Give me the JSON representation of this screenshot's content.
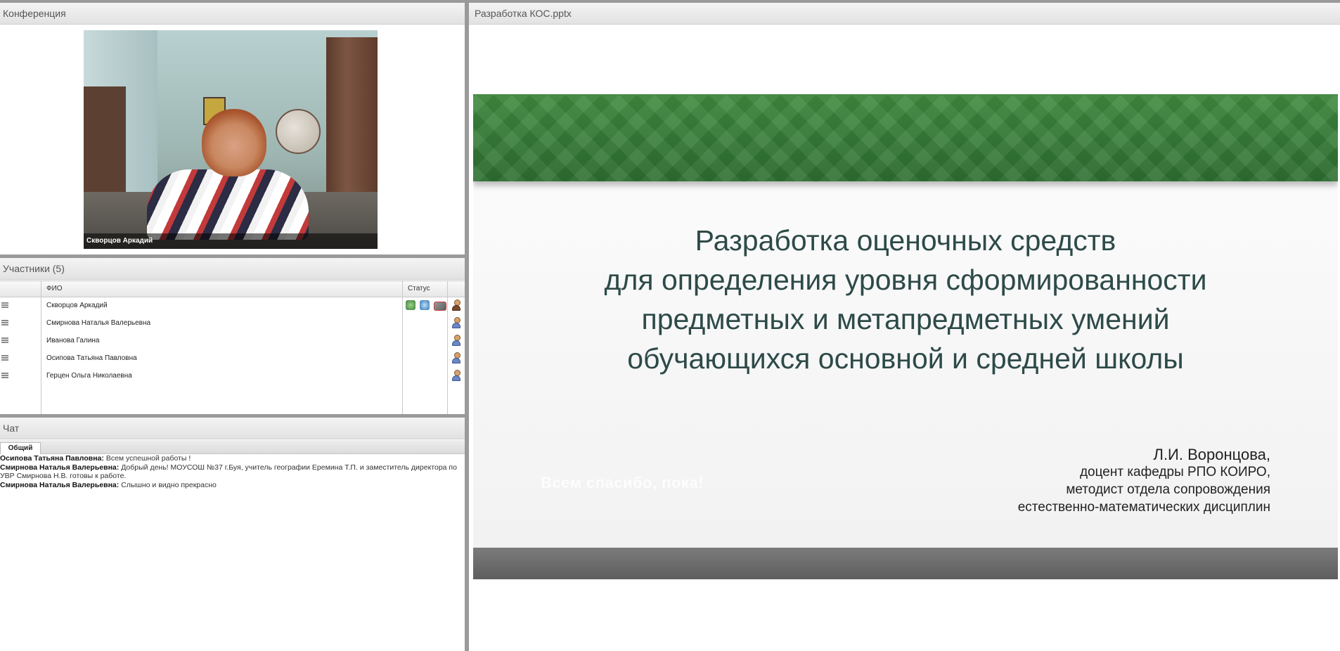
{
  "conference": {
    "title": "Конференция",
    "video_label": "Скворцов Аркадий"
  },
  "participants": {
    "title": "Участники (5)",
    "columns": {
      "name": "ФИО",
      "status": "Статус"
    },
    "rows": [
      {
        "name": "Скворцов Аркадий"
      },
      {
        "name": "Смирнова Наталья Валерьевна"
      },
      {
        "name": "Иванова Галина"
      },
      {
        "name": "Осипова Татьяна Павловна"
      },
      {
        "name": "Герцен Ольга Николаевна"
      }
    ]
  },
  "chat": {
    "title": "Чат",
    "tab": "Общий",
    "messages": [
      {
        "author": "Осипова Татьяна Павловна:",
        "text": "Всем успешной работы !"
      },
      {
        "author": "Смирнова Наталья Валерьевна:",
        "text": "Добрый день! МОУСОШ №37 г.Буя, учитель географии Еремина Т.П. и заместитель директора по УВР Смирнова Н.В. готовы к работе."
      },
      {
        "author": "Смирнова Наталья Валерьевна:",
        "text": "Слышно и видно прекрасно"
      }
    ]
  },
  "presentation": {
    "title": "Разработка КОС.pptx",
    "slide_title_lines": [
      "Разработка оценочных средств",
      "для определения уровня сформированности",
      "предметных и метапредметных умений",
      "обучающихся основной и средней школы"
    ],
    "author_lines": [
      "Л.И. Воронцова,",
      "доцент кафедры  РПО КОИРО,",
      "методист отдела сопровождения",
      "естественно-математических дисциплин"
    ],
    "overlay_text": "Всем спасибо, пока!"
  },
  "colors": {
    "slide_green": "#2e6f31",
    "slide_title": "#2d4a48",
    "splitter": "#9a9a9a"
  }
}
